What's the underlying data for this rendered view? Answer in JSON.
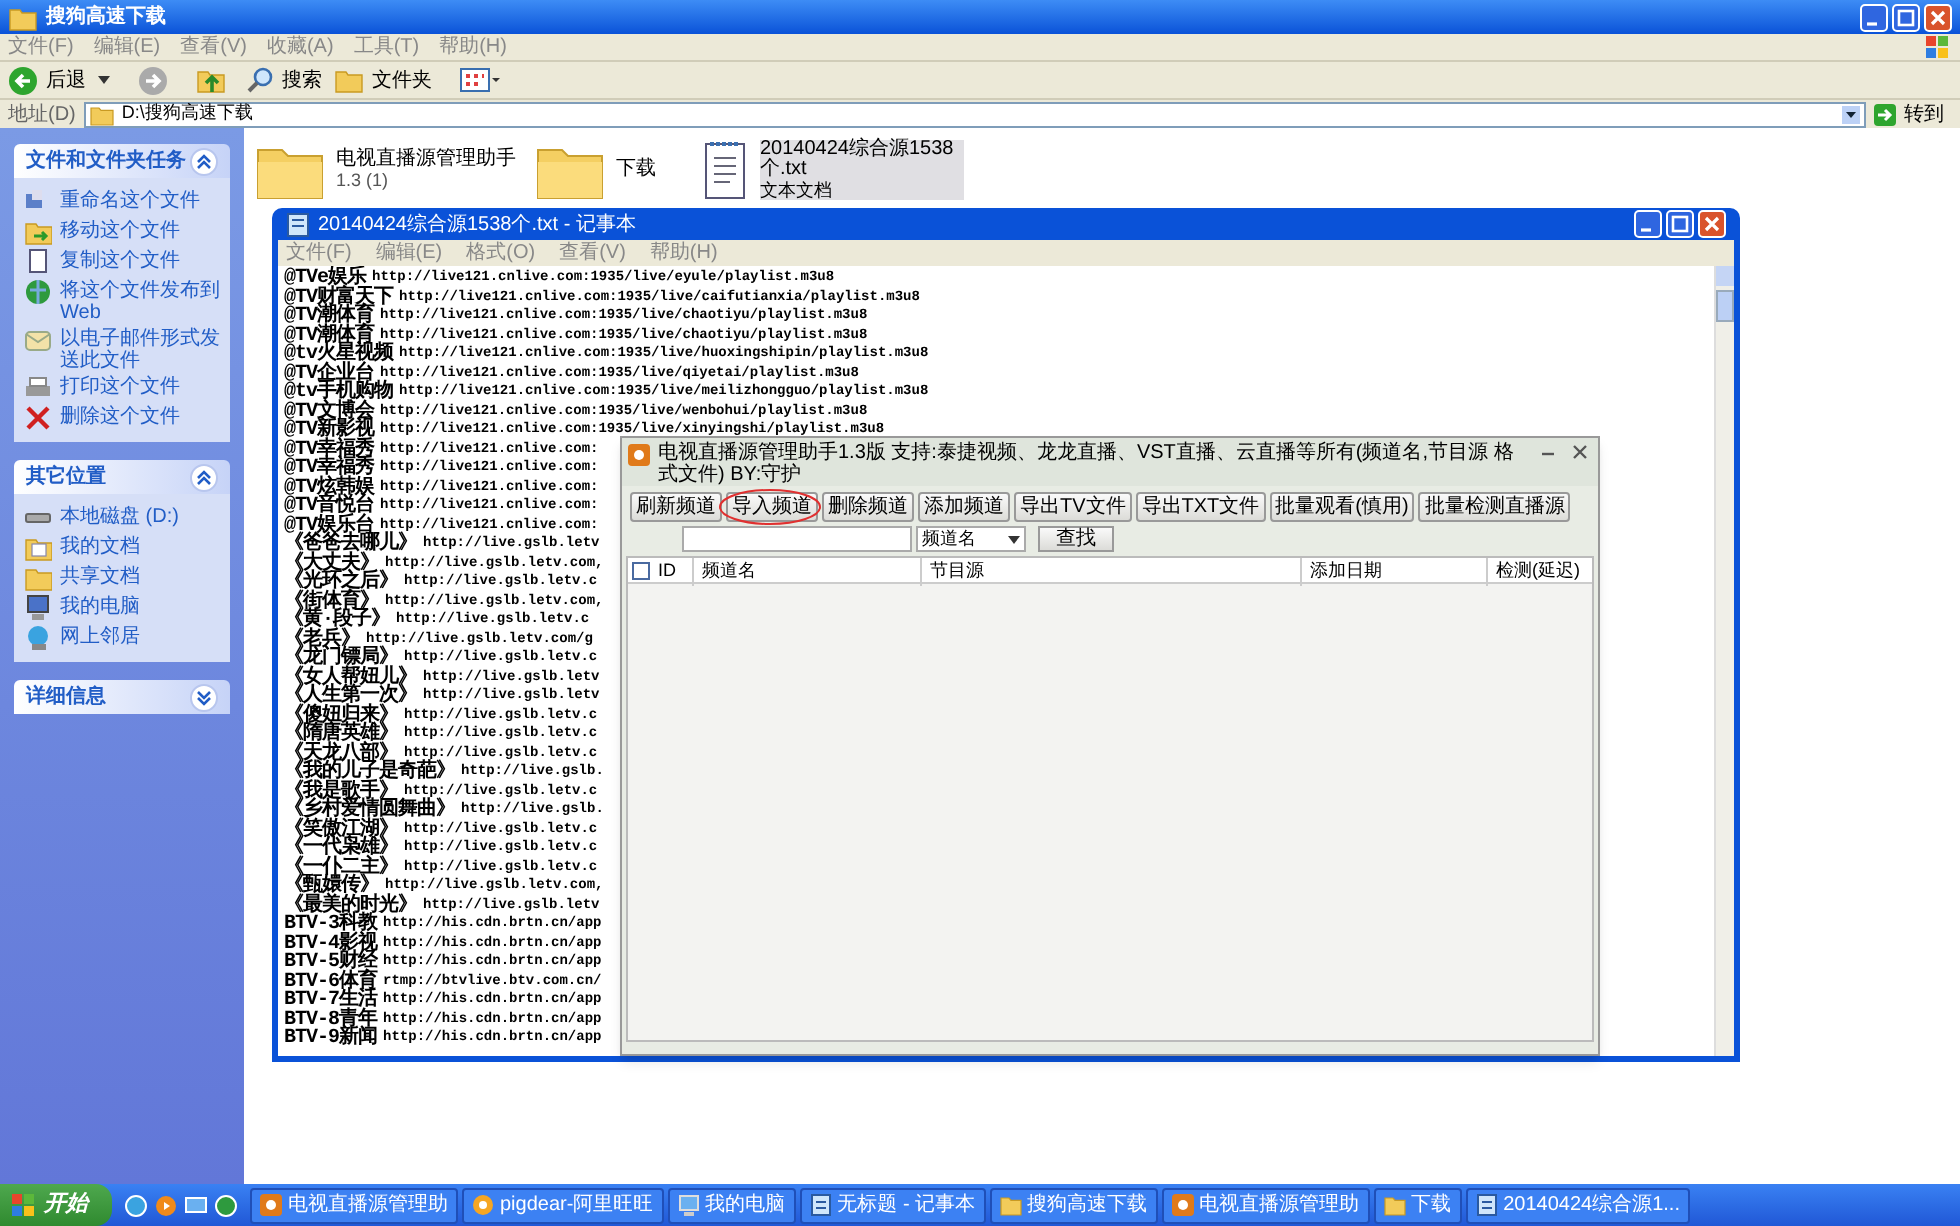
{
  "explorer": {
    "title": "搜狗高速下载",
    "menu": [
      "文件(F)",
      "编辑(E)",
      "查看(V)",
      "收藏(A)",
      "工具(T)",
      "帮助(H)"
    ],
    "toolbar": {
      "back": "后退",
      "search": "搜索",
      "folders": "文件夹"
    },
    "address": {
      "label": "地址(D)",
      "value": "D:\\搜狗高速下载",
      "go": "转到"
    },
    "task_panels": [
      {
        "title": "文件和文件夹任务",
        "expanded": true,
        "items": [
          "重命名这个文件",
          "移动这个文件",
          "复制这个文件",
          "将这个文件发布到 Web",
          "以电子邮件形式发送此文件",
          "打印这个文件",
          "删除这个文件"
        ]
      },
      {
        "title": "其它位置",
        "expanded": true,
        "items": [
          "本地磁盘 (D:)",
          "我的文档",
          "共享文档",
          "我的电脑",
          "网上邻居"
        ]
      },
      {
        "title": "详细信息",
        "expanded": false
      }
    ],
    "files": [
      {
        "kind": "folder",
        "name": "电视直播源管理助手",
        "detail": "1.3 (1)",
        "selected": false
      },
      {
        "kind": "folder",
        "name": "下载",
        "selected": false
      },
      {
        "kind": "text",
        "name": "20140424综合源1538个.txt",
        "detail": "文本文档",
        "selected": true
      }
    ]
  },
  "notepad": {
    "title": "20140424综合源1538个.txt - 记事本",
    "menu": [
      "文件(F)",
      "编辑(E)",
      "格式(O)",
      "查看(V)",
      "帮助(H)"
    ],
    "lines": [
      {
        "name": "@TVe娱乐",
        "url": "http://live121.cnlive.com:1935/live/eyule/playlist.m3u8"
      },
      {
        "name": "@TV财富天下",
        "url": "http://live121.cnlive.com:1935/live/caifutianxia/playlist.m3u8"
      },
      {
        "name": "@TV潮体育",
        "url": "http://live121.cnlive.com:1935/live/chaotiyu/playlist.m3u8"
      },
      {
        "name": "@TV潮体育",
        "url": "http://live121.cnlive.com:1935/live/chaotiyu/playlist.m3u8"
      },
      {
        "name": "@tv火星视频",
        "url": "http://live121.cnlive.com:1935/live/huoxingshipin/playlist.m3u8"
      },
      {
        "name": "@TV企业台",
        "url": "http://live121.cnlive.com:1935/live/qiyetai/playlist.m3u8"
      },
      {
        "name": "@tv手机购物",
        "url": "http://live121.cnlive.com:1935/live/meilizhongguo/playlist.m3u8"
      },
      {
        "name": "@TV文博会",
        "url": "http://live121.cnlive.com:1935/live/wenbohui/playlist.m3u8"
      },
      {
        "name": "@TV新影视",
        "url": "http://live121.cnlive.com:1935/live/xinyingshi/playlist.m3u8"
      },
      {
        "name": "@TV幸福秀",
        "url": "http://live121.cnlive.com:"
      },
      {
        "name": "@TV幸福秀",
        "url": "http://live121.cnlive.com:"
      },
      {
        "name": "@TV炫韩娱",
        "url": "http://live121.cnlive.com:"
      },
      {
        "name": "@TV音悦台",
        "url": "http://live121.cnlive.com:"
      },
      {
        "name": "@TV娱乐台",
        "url": "http://live121.cnlive.com:"
      },
      {
        "name": "《爸爸去哪儿》",
        "url": "http://live.gslb.letv"
      },
      {
        "name": "《大丈夫》",
        "url": "http://live.gslb.letv.com,"
      },
      {
        "name": "《光环之后》",
        "url": "http://live.gslb.letv.c"
      },
      {
        "name": "《街体育》",
        "url": "http://live.gslb.letv.com,"
      },
      {
        "name": "《黄·段子》",
        "url": "http://live.gslb.letv.c"
      },
      {
        "name": "《老兵》",
        "url": "http://live.gslb.letv.com/g"
      },
      {
        "name": "《龙门镖局》",
        "url": "http://live.gslb.letv.c"
      },
      {
        "name": "《女人帮妞儿》",
        "url": "http://live.gslb.letv"
      },
      {
        "name": "《人生第一次》",
        "url": "http://live.gslb.letv"
      },
      {
        "name": "《傻妞归来》",
        "url": "http://live.gslb.letv.c"
      },
      {
        "name": "《隋唐英雄》",
        "url": "http://live.gslb.letv.c"
      },
      {
        "name": "《天龙八部》",
        "url": "http://live.gslb.letv.c"
      },
      {
        "name": "《我的儿子是奇葩》",
        "url": "http://live.gslb."
      },
      {
        "name": "《我是歌手》",
        "url": "http://live.gslb.letv.c"
      },
      {
        "name": "《乡村爱情圆舞曲》",
        "url": "http://live.gslb."
      },
      {
        "name": "《笑傲江湖》",
        "url": "http://live.gslb.letv.c"
      },
      {
        "name": "《一代枭雄》",
        "url": "http://live.gslb.letv.c"
      },
      {
        "name": "《一仆二主》",
        "url": "http://live.gslb.letv.c"
      },
      {
        "name": "《甄嬛传》",
        "url": "http://live.gslb.letv.com,"
      },
      {
        "name": "《最美的时光》",
        "url": "http://live.gslb.letv"
      },
      {
        "name": "BTV-3科教",
        "url": "http://his.cdn.brtn.cn/app"
      },
      {
        "name": "BTV-4影视",
        "url": "http://his.cdn.brtn.cn/app"
      },
      {
        "name": "BTV-5财经",
        "url": "http://his.cdn.brtn.cn/app"
      },
      {
        "name": "BTV-6体育",
        "url": "rtmp://btvlive.btv.com.cn/"
      },
      {
        "name": "BTV-7生活",
        "url": "http://his.cdn.brtn.cn/app"
      },
      {
        "name": "BTV-8青年",
        "url": "http://his.cdn.brtn.cn/app"
      },
      {
        "name": "BTV-9新闻",
        "url": "http://his.cdn.brtn.cn/app"
      }
    ]
  },
  "dialog": {
    "title": "电视直播源管理助手1.3版  支持:泰捷视频、龙龙直播、VST直播、云直播等所有(频道名,节目源  格式文件) BY:守护",
    "buttons": [
      {
        "label": "刷新频道",
        "circled": false
      },
      {
        "label": "导入频道",
        "circled": true
      },
      {
        "label": "删除频道",
        "circled": false
      },
      {
        "label": "添加频道",
        "circled": false
      },
      {
        "label": "导出TV文件",
        "circled": false
      },
      {
        "label": "导出TXT文件",
        "circled": false
      },
      {
        "label": "批量观看(慎用)",
        "circled": false
      },
      {
        "label": "批量检测直播源",
        "circled": false
      }
    ],
    "search_field": "频道名",
    "search_button": "查找",
    "table": {
      "select_all": {
        "checked": false
      },
      "columns": [
        "ID",
        "频道名",
        "节目源",
        "添加日期",
        "检测(延迟)"
      ]
    }
  },
  "taskbar": {
    "start": "开始",
    "items": [
      {
        "kind": "app",
        "label": "电视直播源管理助"
      },
      {
        "kind": "chat",
        "label": "pigdear-阿里旺旺"
      },
      {
        "kind": "computer",
        "label": "我的电脑"
      },
      {
        "kind": "notepad",
        "label": "无标题 - 记事本"
      },
      {
        "kind": "folder",
        "label": "搜狗高速下载"
      },
      {
        "kind": "app",
        "label": "电视直播源管理助"
      },
      {
        "kind": "folder",
        "label": "下载"
      },
      {
        "kind": "notepad",
        "label": "20140424综合源1..."
      }
    ]
  }
}
